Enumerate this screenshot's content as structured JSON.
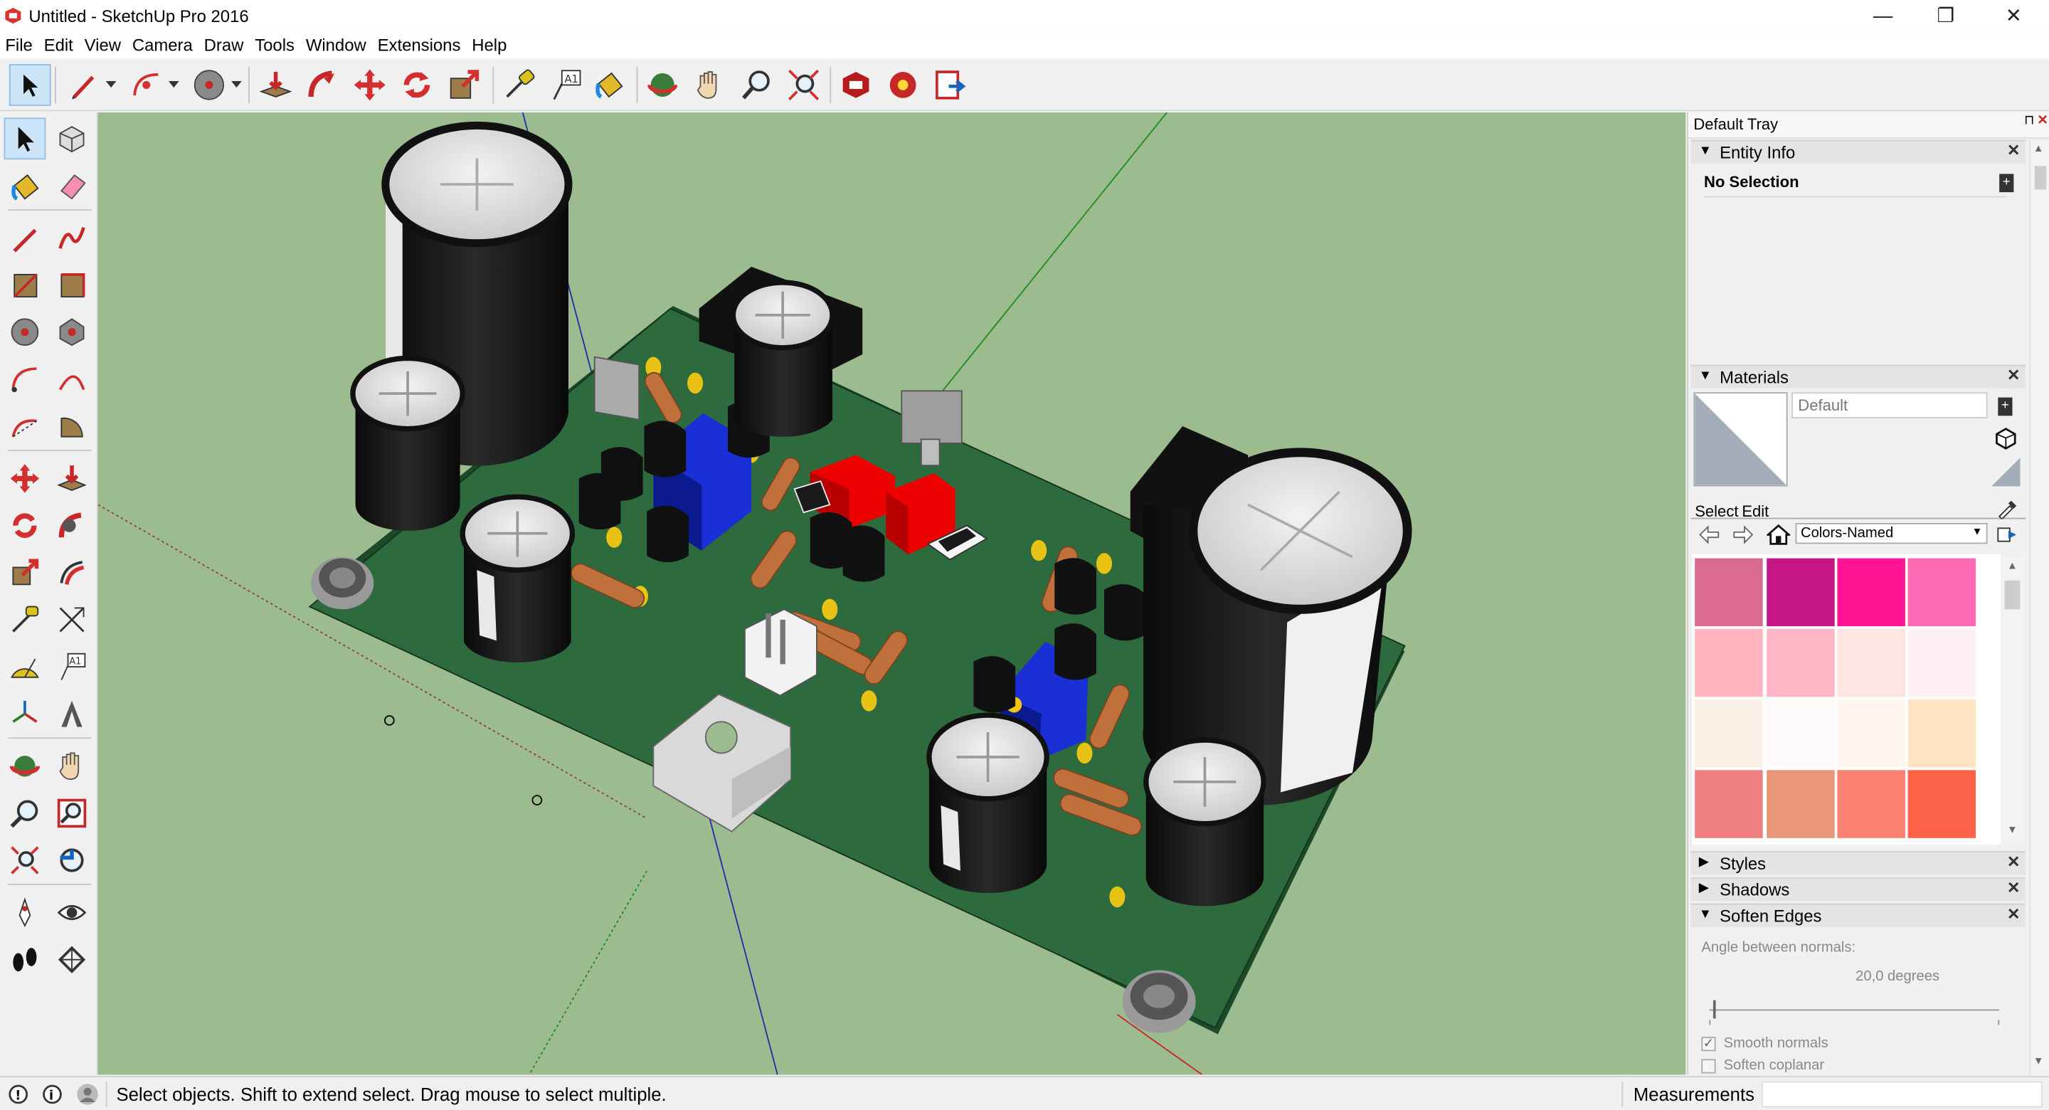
{
  "window": {
    "title": "Untitled - SketchUp Pro 2016",
    "icon": "sketchup-logo-icon",
    "minimize": "—",
    "maximize": "❐",
    "close": "✕"
  },
  "menu": [
    "File",
    "Edit",
    "View",
    "Camera",
    "Draw",
    "Tools",
    "Window",
    "Extensions",
    "Help"
  ],
  "toolbar_icons": [
    "select-arrow-icon",
    "pencil-line-icon",
    "dropdown-arrow-icon",
    "arc-icon",
    "dropdown-arrow-icon",
    "circle-icon",
    "dropdown-arrow-icon",
    "push-pull-icon",
    "follow-me-icon",
    "move-icon",
    "rotate-icon",
    "scale-icon",
    "tape-measure-icon",
    "text-label-icon",
    "paint-bucket-icon",
    "orbit-icon",
    "pan-hand-icon",
    "zoom-icon",
    "zoom-extents-icon",
    "3d-warehouse-icon",
    "extension-warehouse-icon",
    "layout-send-icon"
  ],
  "left_tools": [
    "select-arrow-icon",
    "make-component-icon",
    "paint-bucket-icon",
    "eraser-icon",
    "line-icon",
    "freehand-icon",
    "rectangle-icon",
    "rotated-rectangle-icon",
    "circle-icon",
    "polygon-icon",
    "arc-icon",
    "two-point-arc-icon",
    "three-point-arc-icon",
    "pie-icon",
    "move-icon",
    "push-pull-icon",
    "rotate-icon",
    "follow-me-icon",
    "scale-icon",
    "offset-icon",
    "tape-measure-icon",
    "dimension-icon",
    "protractor-icon",
    "text-icon",
    "axes-icon",
    "3d-text-icon",
    "orbit-icon",
    "pan-icon",
    "zoom-icon",
    "zoom-window-icon",
    "zoom-extents-icon",
    "previous-view-icon",
    "position-camera-icon",
    "look-around-icon",
    "walk-icon",
    "section-plane-icon"
  ],
  "tray": {
    "title": "Default Tray",
    "pin": "⊓",
    "close": "✕",
    "entity_info": {
      "label": "Entity Info",
      "selection": "No Selection"
    },
    "materials": {
      "label": "Materials",
      "current": "Default",
      "tabs": [
        "Select",
        "Edit"
      ],
      "library": "Colors-Named",
      "swatches": [
        "#d96b92",
        "#c71585",
        "#ff1493",
        "#ff69b4",
        "#ffb6c1",
        "#ffb6c6",
        "#ffe4e1",
        "#fff0f5",
        "#faf0e6",
        "#fffafa",
        "#fff5ee",
        "#ffe4c4",
        "#f08080",
        "#e9967a",
        "#fa8072",
        "#ff6347"
      ]
    },
    "styles": {
      "label": "Styles"
    },
    "shadows": {
      "label": "Shadows"
    },
    "soften_edges": {
      "label": "Soften Edges",
      "angle_label": "Angle between normals:",
      "angle_value": "20,0  degrees",
      "slider_value": 0.2,
      "smooth_normals": "Smooth normals",
      "smooth_checked": true,
      "soften_coplanar": "Soften coplanar",
      "coplanar_checked": false
    }
  },
  "status": {
    "hint": "Select objects. Shift to extend select. Drag mouse to select multiple.",
    "measurements_label": "Measurements"
  },
  "colors": {
    "viewport_bg": "#9cbc8f",
    "pcb": "#2d6a3e",
    "capacitor": "#1a1a1a",
    "pot": "#1a2fd6",
    "relay": "#ee0000",
    "resistor": "#c0703a"
  }
}
